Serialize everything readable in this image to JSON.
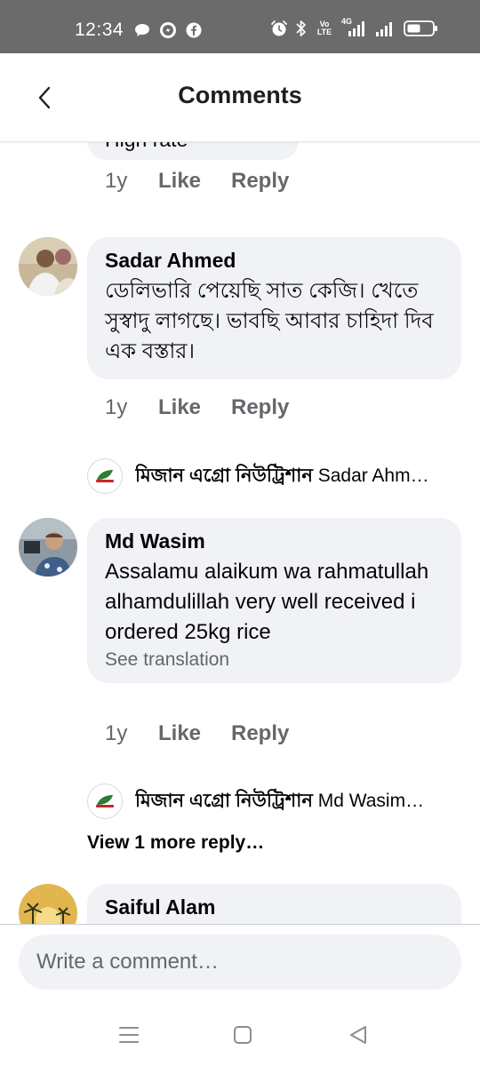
{
  "status_bar": {
    "time": "12:34",
    "left_icons": [
      "chat-bubble-icon",
      "messenger-icon",
      "facebook-icon"
    ],
    "right_icons": [
      "alarm-icon",
      "bluetooth-icon",
      "volte-icon",
      "signal-4g-icon",
      "signal-icon",
      "battery-icon"
    ],
    "volte_line1": "Vo",
    "volte_line2": "LTE",
    "net_label": "4G"
  },
  "header": {
    "title": "Comments",
    "back_icon": "chevron-left-icon"
  },
  "feed": {
    "cut_comment_text": "High rate",
    "cut_actions": {
      "time": "1y",
      "like": "Like",
      "reply": "Reply"
    },
    "comments": [
      {
        "name": "Sadar Ahmed",
        "text": "ডেলিভারি পেয়েছি সাত কেজি। খেতে সুস্বাদু লাগছে। ভাবছি আবার চাহিদা দিব এক বস্তার।",
        "actions": {
          "time": "1y",
          "like": "Like",
          "reply": "Reply"
        },
        "reply_preview": {
          "author": "মিজান এগ্রো নিউট্রিশান",
          "text": "Sadar Ahm…"
        }
      },
      {
        "name": "Md Wasim",
        "text": "Assalamu alaikum wa rahmatullah alhamdulillah very well received i ordered 25kg rice",
        "see_translation": "See translation",
        "actions": {
          "time": "1y",
          "like": "Like",
          "reply": "Reply"
        },
        "reply_preview": {
          "author": "মিজান এগ্রো নিউট্রিশান",
          "text": "Md Wasim…"
        },
        "view_more": "View 1 more reply…"
      },
      {
        "name": "Saiful Alam"
      }
    ]
  },
  "composer": {
    "placeholder": "Write a comment…"
  },
  "nav": {
    "icons": [
      "recent-apps-icon",
      "home-icon",
      "back-icon"
    ]
  },
  "colors": {
    "status_bar": "#6b6b6b",
    "bubble": "#f0f2f5",
    "secondary_text": "#65676b",
    "brand_green": "#2e7d32"
  }
}
